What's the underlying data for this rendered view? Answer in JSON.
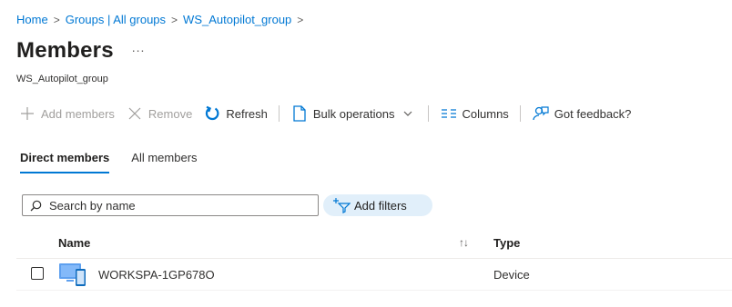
{
  "breadcrumb": {
    "items": [
      "Home",
      "Groups | All groups",
      "WS_Autopilot_group"
    ],
    "separator": ">"
  },
  "header": {
    "title": "Members",
    "more": "...",
    "subtitle": "WS_Autopilot_group"
  },
  "toolbar": {
    "add_members": "Add members",
    "remove": "Remove",
    "refresh": "Refresh",
    "bulk_operations": "Bulk operations",
    "columns": "Columns",
    "feedback": "Got feedback?"
  },
  "tabs": [
    {
      "label": "Direct members",
      "active": true
    },
    {
      "label": "All members",
      "active": false
    }
  ],
  "search": {
    "placeholder": "Search by name",
    "value": ""
  },
  "filters": {
    "label": "Add filters"
  },
  "table": {
    "columns": {
      "name": "Name",
      "sort_glyph": "↑↓",
      "type": "Type"
    },
    "rows": [
      {
        "name": "WORKSPA-1GP678O",
        "type": "Device",
        "icon": "device-icon",
        "checked": false
      }
    ]
  },
  "colors": {
    "accent": "#0078d4",
    "text": "#323130",
    "disabled": "#a19f9d",
    "filter_bg": "#e1effa"
  }
}
